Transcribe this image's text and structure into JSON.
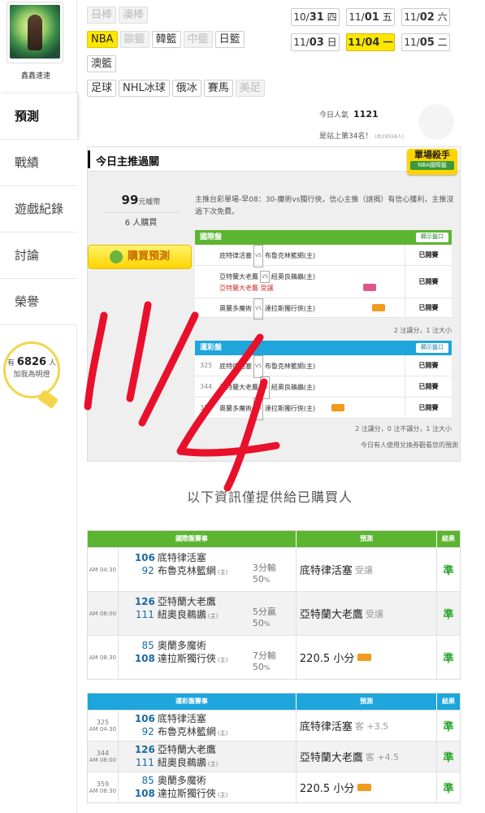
{
  "user": {
    "name": "鑫鑫速速"
  },
  "sidebar": {
    "items": [
      {
        "label": "預測",
        "active": true
      },
      {
        "label": "戰績"
      },
      {
        "label": "遊戲紀錄"
      },
      {
        "label": "討論"
      },
      {
        "label": "榮譽"
      }
    ],
    "bulb": {
      "prefix": "有",
      "count": "6826",
      "suffix": "人",
      "line2": "加我為明燈"
    }
  },
  "filters": {
    "row1": [
      {
        "label": "日棒",
        "state": "dim"
      },
      {
        "label": "澳棒",
        "state": "dim"
      }
    ],
    "row2": [
      {
        "label": "NBA",
        "state": "active"
      },
      {
        "label": "歐籃",
        "state": "dim"
      },
      {
        "label": "韓籃",
        "state": "normal"
      },
      {
        "label": "中籃",
        "state": "dim"
      },
      {
        "label": "日籃",
        "state": "normal"
      }
    ],
    "row3": [
      {
        "label": "澳籃",
        "state": "normal"
      }
    ],
    "row4": [
      {
        "label": "足球",
        "state": "normal"
      },
      {
        "label": "NHL冰球",
        "state": "normal"
      },
      {
        "label": "俄冰",
        "state": "normal"
      },
      {
        "label": "賽馬",
        "state": "normal"
      },
      {
        "label": "美足",
        "state": "dim"
      }
    ]
  },
  "dates": [
    {
      "md": "10/",
      "day": "31",
      "wd": "四",
      "active": false
    },
    {
      "md": "11/",
      "day": "01",
      "wd": "五",
      "active": false
    },
    {
      "md": "11/",
      "day": "02",
      "wd": "六",
      "active": false
    },
    {
      "md": "11/",
      "day": "03",
      "wd": "日",
      "active": false
    },
    {
      "md": "11/",
      "day": "04",
      "wd": "一",
      "active": true
    },
    {
      "md": "11/",
      "day": "05",
      "wd": "二",
      "active": false
    }
  ],
  "stats": {
    "popularity_label": "今日人氣",
    "popularity_value": "1121",
    "rank_text": "是站上第34名！",
    "rank_small": "(共28558人)"
  },
  "pick": {
    "title": "今日主推過關",
    "badge_line1": "單場殺手",
    "badge_line2": "NBA國際盤",
    "price": "99",
    "price_unit": "元噱幣",
    "buyers": "6 人購買",
    "buy_label": "購買預測",
    "description": "主推台彩單場-早08：30-魔術vs獨行俠，信心主推（謎揭）有信心獲利，主推沒過下次免費。",
    "intl": {
      "header": "國際盤",
      "show": "顯示盤口",
      "rows": [
        {
          "away": "底特律活塞",
          "home": "布魯克林籃網(主)",
          "status": "已開賽"
        },
        {
          "away": "亞特蘭大老鷹",
          "home": "紐奧良鵜鶘(主)",
          "extra": "亞特蘭大老鷹 受讓",
          "status": "已開賽"
        },
        {
          "away": "奧蘭多魔術",
          "home": "達拉斯獨行俠(主)",
          "status": "已開賽"
        }
      ],
      "note": "2 注讓分，1 注大小"
    },
    "lottery": {
      "header": "運彩盤",
      "show": "顯示盤口",
      "rows": [
        {
          "num": "325",
          "away": "底特律活塞",
          "home": "布魯克林籃網(主)",
          "status": "已開賽"
        },
        {
          "num": "344",
          "away": "亞特蘭大老鷹",
          "home": "紐奧良鵜鶘(主)",
          "status": "已開賽"
        },
        {
          "num": "359",
          "away": "奧蘭多魔術",
          "home": "達拉斯獨行俠(主)",
          "status": "已開賽"
        }
      ],
      "note": "2 注讓分，0 注不讓分，1 注大小",
      "note2": "今日有人使用兌換券觀看您的預測"
    }
  },
  "info_line": "以下資訊僅提供給已購買人",
  "intl_table": {
    "head": {
      "game": "國際盤賽事",
      "pick": "預測",
      "result": "結果"
    },
    "rows": [
      {
        "time": "AM 04:30",
        "n1": "106",
        "t1": "底特律活塞",
        "n2": "92",
        "t2": "布魯克林籃網",
        "home": "(主)",
        "o1": "3分輸",
        "o2": "50",
        "pick": "底特律活塞",
        "pick_extra": "受讓",
        "result": "準"
      },
      {
        "time": "AM 08:00",
        "n1": "126",
        "t1": "亞特蘭大老鷹",
        "n2": "111",
        "t2": "紐奧良鵜鶘",
        "home": "(主)",
        "o1": "5分贏",
        "o2": "50",
        "pick": "亞特蘭大老鷹",
        "pick_extra": "受讓",
        "result": "準"
      },
      {
        "time": "AM 08:30",
        "n1": "85",
        "t1": "奧蘭多魔術",
        "n2": "108",
        "t2": "達拉斯獨行俠",
        "home": "(主)",
        "o1": "7分輸",
        "o2": "50",
        "pick": "220.5 小分",
        "pick_extra": "",
        "result": "準"
      }
    ]
  },
  "lottery_table": {
    "head": {
      "game": "運彩盤賽事",
      "pick": "預測",
      "result": "結果"
    },
    "rows": [
      {
        "code": "325",
        "time": "AM 04:30",
        "n1": "106",
        "t1": "底特律活塞",
        "n2": "92",
        "t2": "布魯克林籃網",
        "home": "(主)",
        "pick": "底特律活塞",
        "pick_extra": "客 +3.5",
        "result": "準"
      },
      {
        "code": "344",
        "time": "AM 08:00",
        "n1": "126",
        "t1": "亞特蘭大老鷹",
        "n2": "111",
        "t2": "紐奧良鵜鶘",
        "home": "(主)",
        "pick": "亞特蘭大老鷹",
        "pick_extra": "客 +4.5",
        "result": "準"
      },
      {
        "code": "359",
        "time": "AM 08:30",
        "n1": "85",
        "t1": "奧蘭多魔術",
        "n2": "108",
        "t2": "達拉斯獨行俠",
        "home": "(主)",
        "pick": "220.5 小分",
        "pick_extra": "",
        "result": "準"
      }
    ]
  },
  "colors": {
    "accent_yellow": "#ffe600",
    "intl_green": "#5cb531",
    "lottery_blue": "#1ea5dc",
    "win_green": "#2aa52a",
    "scribble_red": "#e8102a"
  }
}
